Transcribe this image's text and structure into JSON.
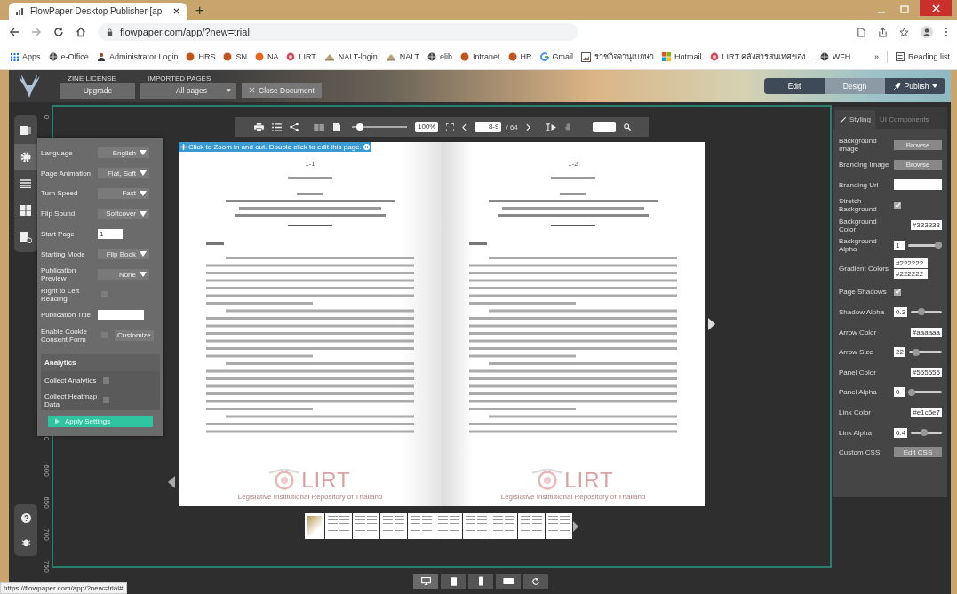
{
  "browser": {
    "tab_title": "FlowPaper Desktop Publisher [ap",
    "new_tab": "+",
    "url": "flowpaper.com/app/?new=trial",
    "bookmarks": [
      {
        "label": "Apps",
        "kind": "apps"
      },
      {
        "label": "e-Office",
        "kind": "globe"
      },
      {
        "label": "Administrator Login",
        "kind": "person"
      },
      {
        "label": "HRS",
        "kind": "dot",
        "color": "#c0531e"
      },
      {
        "label": "SN",
        "kind": "dot",
        "color": "#c0531e"
      },
      {
        "label": "NA",
        "kind": "dot",
        "color": "#e8671c"
      },
      {
        "label": "LIRT",
        "kind": "target"
      },
      {
        "label": "NALT-login",
        "kind": "emblem"
      },
      {
        "label": "NALT",
        "kind": "emblem"
      },
      {
        "label": "elib",
        "kind": "globe"
      },
      {
        "label": "Intranet",
        "kind": "dot",
        "color": "#c0531e"
      },
      {
        "label": "HR",
        "kind": "dot",
        "color": "#c0531e"
      },
      {
        "label": "Gmail",
        "kind": "google"
      },
      {
        "label": "ราชกิจจานุเบกษา",
        "kind": "picture"
      },
      {
        "label": "Hotmail",
        "kind": "windows"
      },
      {
        "label": "LIRT คลังสารสนเทศของ...",
        "kind": "target"
      },
      {
        "label": "WFH",
        "kind": "globe"
      }
    ],
    "overflow": "»",
    "reading_list": "Reading list"
  },
  "header": {
    "license_caption": "ZINE LICENSE",
    "upgrade": "Upgrade",
    "pages_caption": "IMPORTED PAGES",
    "pages_select": "All pages",
    "close": "Close Document",
    "modes": [
      {
        "label": "Edit",
        "selected": false
      },
      {
        "label": "Design",
        "selected": true
      },
      {
        "label": "Publish",
        "selected": false
      }
    ]
  },
  "rail": [
    {
      "kind": "pages",
      "selected": false
    },
    {
      "kind": "settings",
      "selected": true
    },
    {
      "kind": "list",
      "selected": false
    },
    {
      "kind": "grid",
      "selected": false
    },
    {
      "kind": "export",
      "selected": false
    }
  ],
  "ruler_labels": [
    "0",
    "0",
    "600",
    "650",
    "700",
    "750"
  ],
  "settings": {
    "rows": [
      {
        "label": "Language",
        "kind": "select",
        "value": "English"
      },
      {
        "label": "Page Animation",
        "kind": "select",
        "value": "Flat, Soft"
      },
      {
        "label": "Turn Speed",
        "kind": "select",
        "value": "Fast"
      },
      {
        "label": "Flip Sound",
        "kind": "select",
        "value": "Softcover"
      },
      {
        "label": "Start Page",
        "kind": "number",
        "value": "1"
      },
      {
        "label": "Starting Mode",
        "kind": "select",
        "value": "Flip Book"
      },
      {
        "label": "Publication Preview",
        "kind": "select",
        "value": "None"
      },
      {
        "label": "Right to Left Reading",
        "kind": "check",
        "checked": false
      },
      {
        "label": "Publication Title",
        "kind": "text"
      },
      {
        "label": "Enable Cookie Consent Form",
        "kind": "check_button",
        "checked": false,
        "button": "Customize"
      }
    ],
    "analytics": {
      "title": "Analytics",
      "rows": [
        {
          "label": "Collect Analytics",
          "checked": false
        },
        {
          "label": "Collect Heatmap Data",
          "checked": false
        }
      ]
    },
    "apply": "Apply Settings"
  },
  "viewer": {
    "toolbar": {
      "level": 0.15,
      "zoom": "100%",
      "page": "8-9",
      "total": "/ 64"
    },
    "hint": "Click to Zoom in and out. Double click to edit this page.",
    "pages": [
      {
        "number": "1-1",
        "logo": "LIRT",
        "caption": "Legislative Institutional Repository of Thailand"
      },
      {
        "number": "1-2",
        "logo": "LIRT",
        "caption": "Legislative Institutional Repository of Thailand"
      }
    ]
  },
  "styling": {
    "tabs": [
      {
        "label": "Styling",
        "selected": true
      },
      {
        "label": "UI Components",
        "selected": false
      }
    ],
    "rows": [
      {
        "label": "Background Image",
        "kind": "button",
        "value": "Browse"
      },
      {
        "label": "Branding Image",
        "kind": "button",
        "value": "Browse"
      },
      {
        "label": "Branding Url",
        "kind": "text"
      },
      {
        "label": "Stretch Background",
        "kind": "check",
        "checked": true
      },
      {
        "label": "Background Color",
        "kind": "text",
        "value": "#333333"
      },
      {
        "label": "Background Alpha",
        "kind": "slider",
        "value": "1",
        "level": 1
      },
      {
        "label": "Gradient Colors",
        "kind": "pair",
        "values": [
          "#222222",
          "#222222"
        ]
      },
      {
        "label": "Page Shadows",
        "kind": "check",
        "checked": true
      },
      {
        "label": "Shadow Alpha",
        "kind": "slider",
        "value": "0.3",
        "level": 0.3
      },
      {
        "label": "Arrow Color",
        "kind": "text",
        "value": "#aaaaaa"
      },
      {
        "label": "Arrow Size",
        "kind": "slider",
        "value": "22",
        "level": 0.15
      },
      {
        "label": "Panel Color",
        "kind": "text",
        "value": "#555555"
      },
      {
        "label": "Panel Alpha",
        "kind": "slider",
        "value": "0",
        "level": 0
      },
      {
        "label": "Link Color",
        "kind": "text",
        "value": "#e1c5e7"
      },
      {
        "label": "Link Alpha",
        "kind": "slider",
        "value": "0.4",
        "level": 0.4
      },
      {
        "label": "Custom CSS",
        "kind": "button",
        "value": "Edit CSS"
      }
    ]
  },
  "devices": [
    {
      "kind": "desktop",
      "selected": true
    },
    {
      "kind": "tablet",
      "selected": false
    },
    {
      "kind": "phone",
      "selected": false
    },
    {
      "kind": "landscape",
      "selected": false
    },
    {
      "kind": "rotate",
      "selected": false
    }
  ],
  "status_url": "https://flowpaper.com/app/?new=trial#"
}
